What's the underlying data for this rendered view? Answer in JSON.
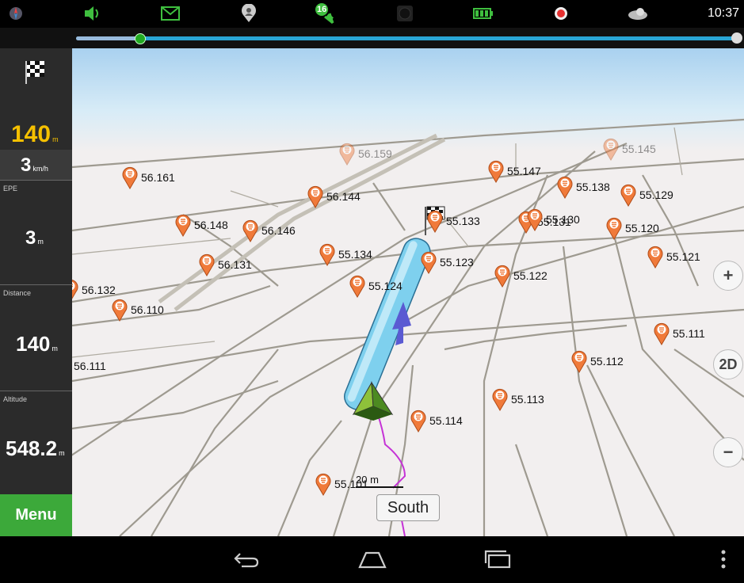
{
  "status_bar": {
    "time": "10:37",
    "icons": [
      "compass-icon",
      "volume-icon",
      "mail-icon",
      "person-pin-icon",
      "satellite-icon",
      "record-dark-icon",
      "battery-icon",
      "record-icon",
      "weather-icon"
    ],
    "satellite_count": "16",
    "colors": {
      "volume": "#3fbf3f",
      "mail": "#3fbf3f",
      "battery": "#3fbf3f",
      "record": "#e53030"
    }
  },
  "route_progress": {
    "fraction": 0.1
  },
  "sidebar": {
    "distance_to_target": {
      "value": "140",
      "unit": "m"
    },
    "speed": {
      "value": "3",
      "unit": "km/h"
    },
    "epe": {
      "label": "EPE",
      "value": "3",
      "unit": "m"
    },
    "distance": {
      "label": "Distance",
      "value": "140",
      "unit": "m"
    },
    "altitude": {
      "label": "Altitude",
      "value": "548.2",
      "unit": "m"
    },
    "menu_label": "Menu",
    "accent_color": "#f5c000"
  },
  "map": {
    "pois": [
      {
        "label": "56.161",
        "far": false
      },
      {
        "label": "56.159",
        "far": true
      },
      {
        "label": "55.145",
        "far": true
      },
      {
        "label": "56.144",
        "far": false
      },
      {
        "label": "55.147",
        "far": false
      },
      {
        "label": "55.138",
        "far": false
      },
      {
        "label": "55.129",
        "far": false
      },
      {
        "label": "56.148",
        "far": false
      },
      {
        "label": "56.146",
        "far": false
      },
      {
        "label": "55.133",
        "far": false
      },
      {
        "label": "55.131",
        "far": false
      },
      {
        "label": "55.130",
        "far": false
      },
      {
        "label": "55.120",
        "far": false
      },
      {
        "label": "56.131",
        "far": false
      },
      {
        "label": "55.134",
        "far": false
      },
      {
        "label": "55.123",
        "far": false
      },
      {
        "label": "55.121",
        "far": false
      },
      {
        "label": "56.132",
        "far": false
      },
      {
        "label": "55.124",
        "far": false
      },
      {
        "label": "55.122",
        "far": false
      },
      {
        "label": "56.110",
        "far": false
      },
      {
        "label": "55.111",
        "far": false
      },
      {
        "label": "56.111",
        "far": false
      },
      {
        "label": "55.112",
        "far": false
      },
      {
        "label": "55.113",
        "far": false
      },
      {
        "label": "55.114",
        "far": false
      },
      {
        "label": "55.101",
        "far": false
      }
    ],
    "scale_label": "20 m",
    "direction_label": "South",
    "mode_button": "2D",
    "zoom_in": "+",
    "zoom_out": "−",
    "route_color": "#7ed0ee",
    "poi_color": "#f07a3a"
  },
  "nav_bar": {
    "icons": [
      "back-icon",
      "home-icon",
      "recents-icon",
      "overflow-menu-icon"
    ]
  }
}
